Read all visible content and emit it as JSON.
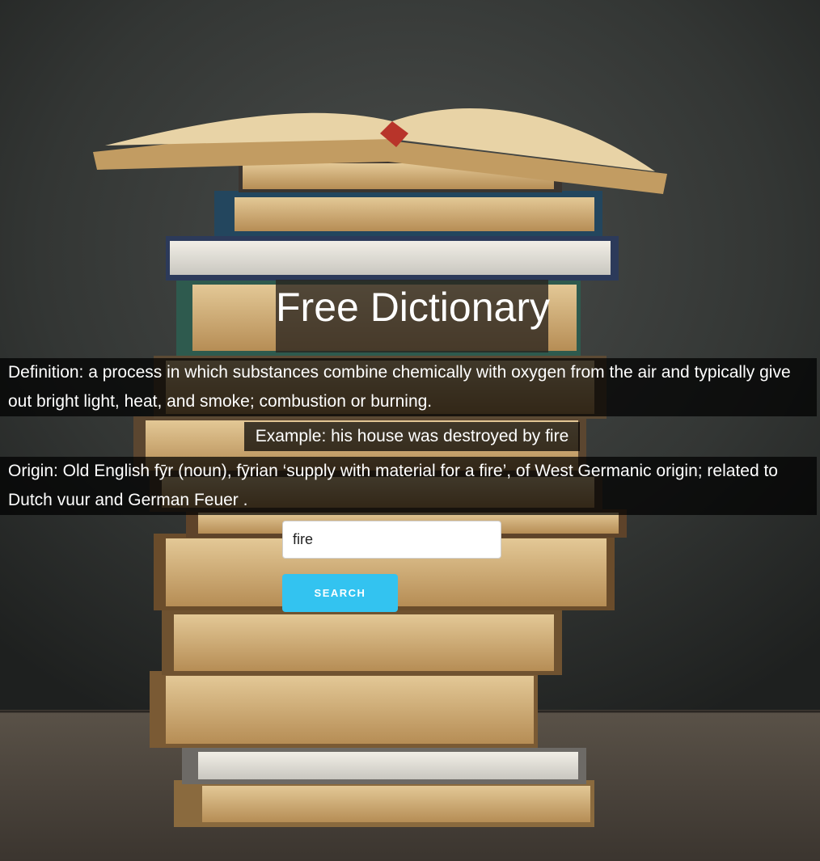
{
  "page": {
    "title": "Free Dictionary"
  },
  "entry": {
    "definition": "Definition: a process in which substances combine chemically with oxygen from the air and typically give out bright light, heat, and smoke; combustion or burning.",
    "example": "Example: his house was destroyed by fire",
    "origin": "Origin: Old English fȳr (noun), fȳrian ‘supply with material for a fire’, of West Germanic origin; related to Dutch vuur and German Feuer ."
  },
  "search": {
    "value": "fire",
    "button_label": "SEARCH"
  },
  "colors": {
    "button": "#33c3f0",
    "panel_background": "#000000",
    "text": "#ffffff"
  },
  "background": {
    "image": "stack-of-books-on-chalkboard-background"
  }
}
